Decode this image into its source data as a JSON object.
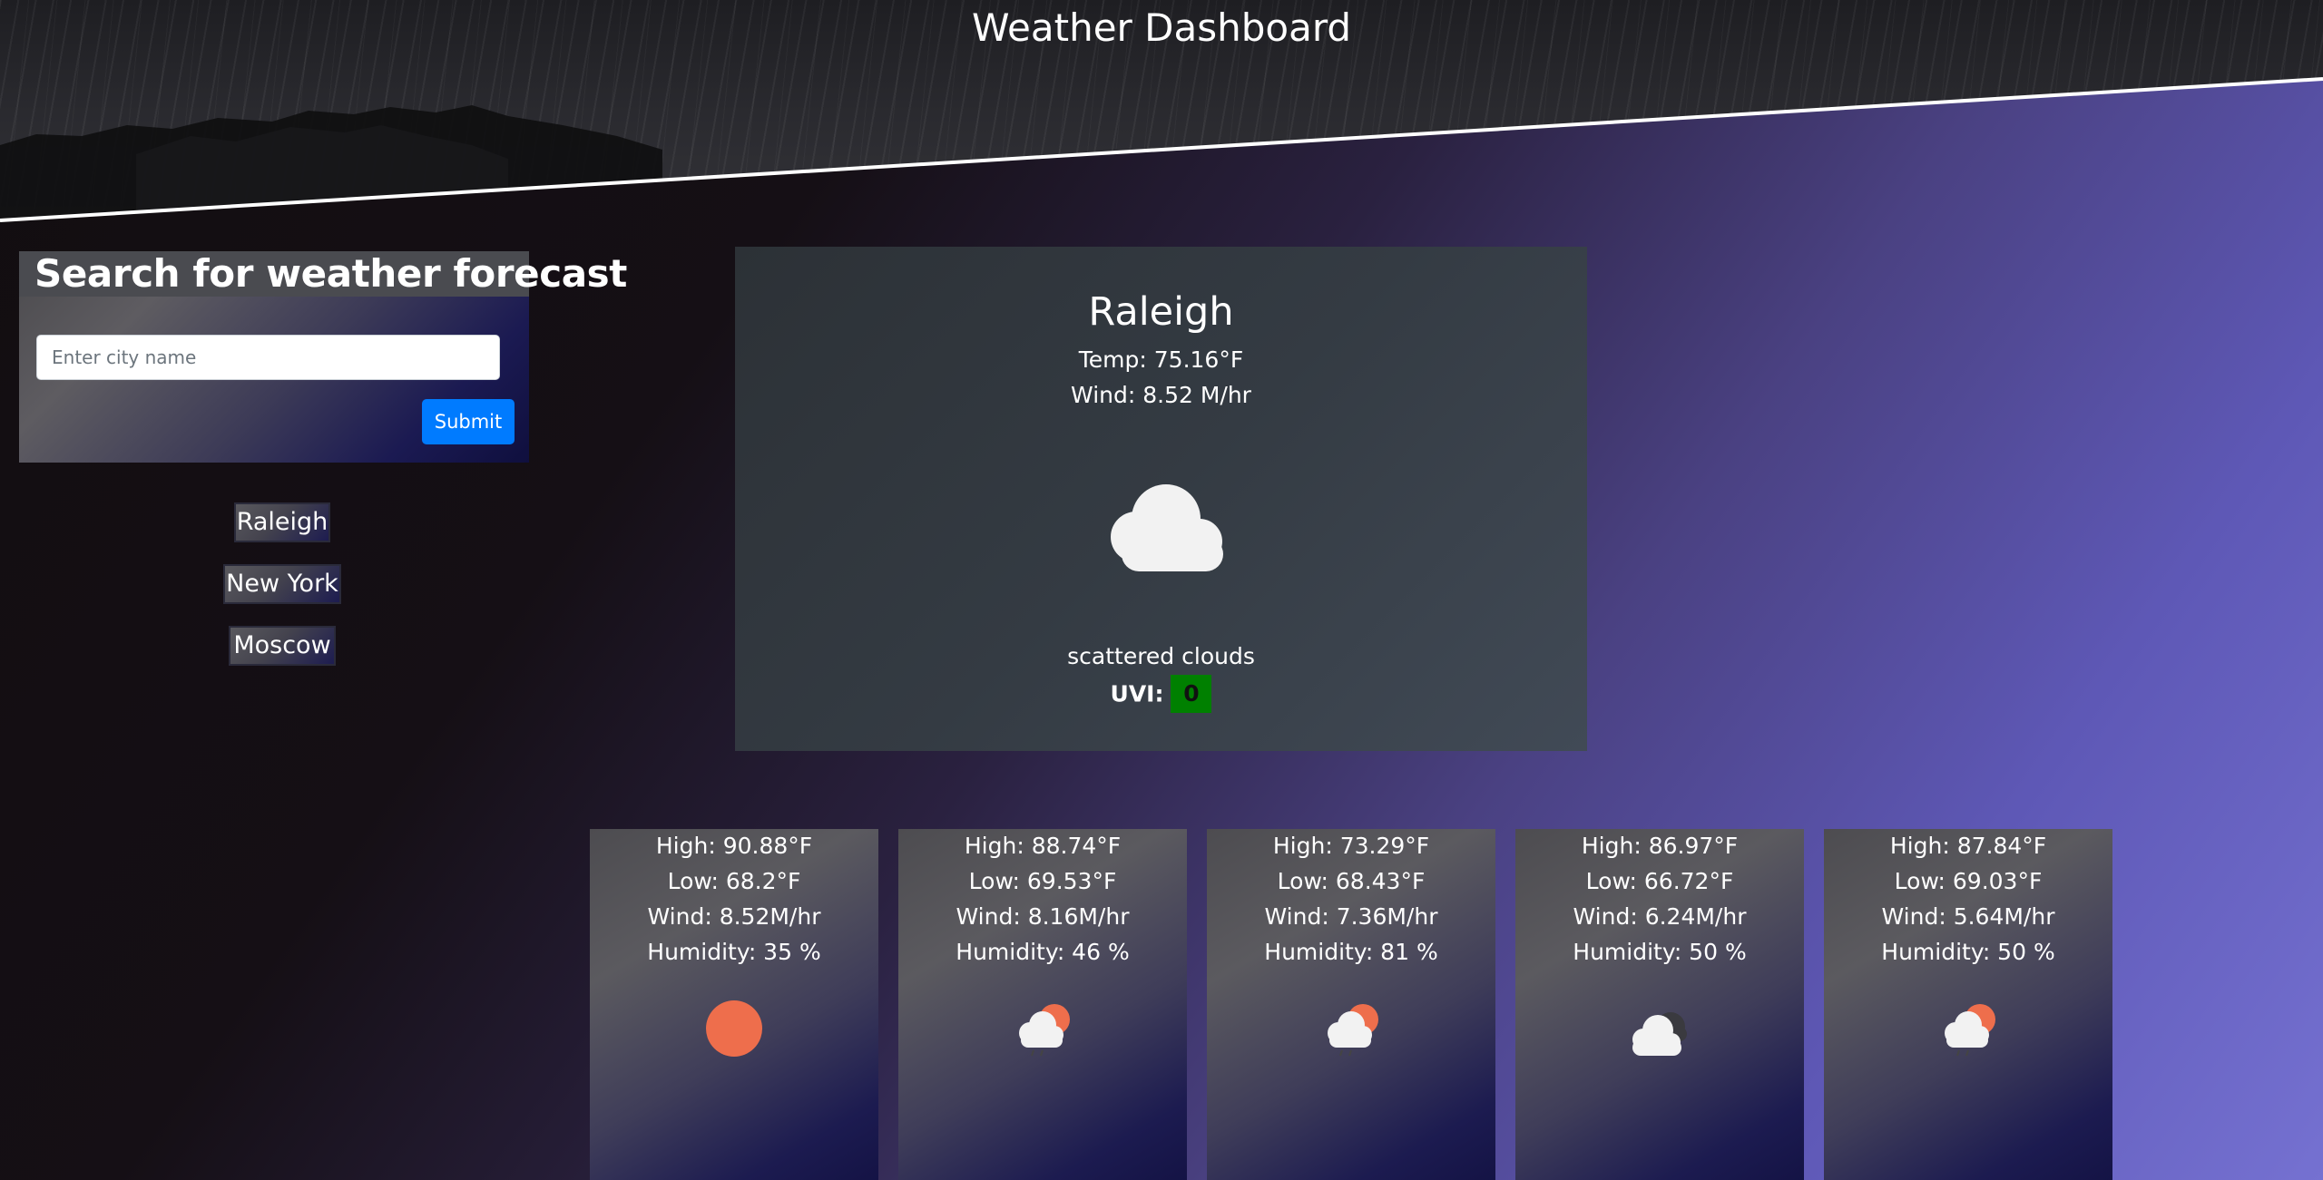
{
  "header": {
    "title": "Weather Dashboard"
  },
  "search": {
    "heading": "Search for weather forecast",
    "placeholder": "Enter city name",
    "value": "",
    "submit_label": "Submit",
    "submit_color": "#007bff"
  },
  "history": [
    {
      "label": "Raleigh"
    },
    {
      "label": "New York"
    },
    {
      "label": "Moscow"
    }
  ],
  "current": {
    "city": "Raleigh",
    "temp": "Temp: 75.16°F",
    "wind": "Wind: 8.52 M/hr",
    "icon": "scattered-clouds-icon",
    "description": "scattered clouds",
    "uvi_label": "UVI:",
    "uvi_value": "0",
    "uvi_color": "#008000"
  },
  "forecast": [
    {
      "high": "High: 90.88°F",
      "low": "Low: 68.2°F",
      "wind": "Wind: 8.52M/hr",
      "humidity": "Humidity: 35 %",
      "icon": "sun-icon"
    },
    {
      "high": "High: 88.74°F",
      "low": "Low: 69.53°F",
      "wind": "Wind: 8.16M/hr",
      "humidity": "Humidity: 46 %",
      "icon": "sun-cloud-rain-icon"
    },
    {
      "high": "High: 73.29°F",
      "low": "Low: 68.43°F",
      "wind": "Wind: 7.36M/hr",
      "humidity": "Humidity: 81 %",
      "icon": "sun-cloud-rain-icon"
    },
    {
      "high": "High: 86.97°F",
      "low": "Low: 66.72°F",
      "wind": "Wind: 6.24M/hr",
      "humidity": "Humidity: 50 %",
      "icon": "broken-clouds-icon"
    },
    {
      "high": "High: 87.84°F",
      "low": "Low: 69.03°F",
      "wind": "Wind: 5.64M/hr",
      "humidity": "Humidity: 50 %",
      "icon": "sun-cloud-rain-icon"
    }
  ]
}
